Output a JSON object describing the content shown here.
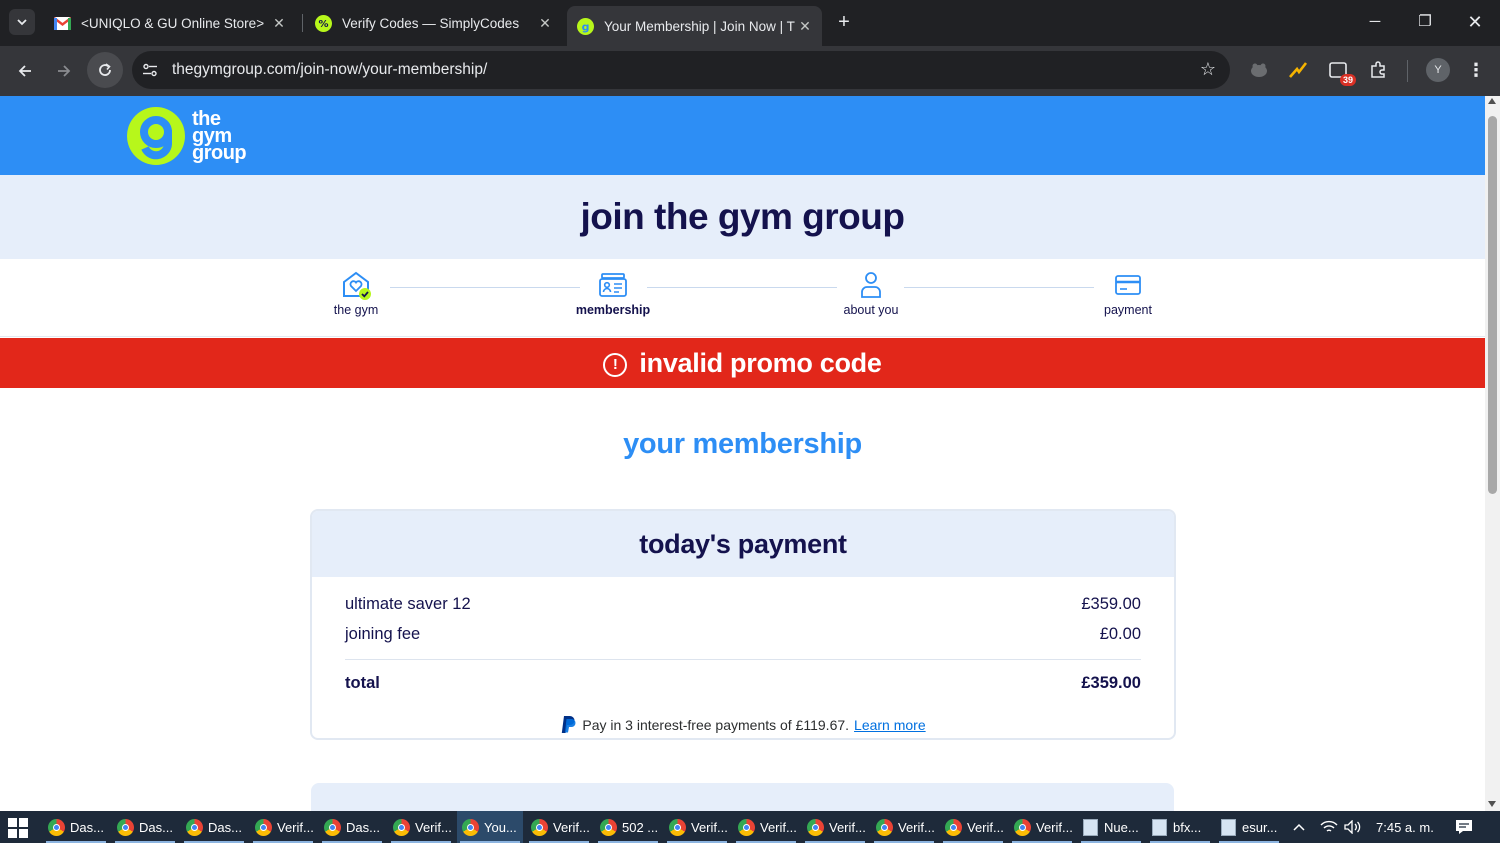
{
  "browser": {
    "tabs": [
      {
        "title": "<UNIQLO & GU Online Store>",
        "favicon": "gmail-icon",
        "active": false
      },
      {
        "title": "Verify Codes — SimplyCodes",
        "favicon": "simplycodes-icon",
        "active": false
      },
      {
        "title": "Your Membership | Join Now | T",
        "favicon": "gymgroup-icon",
        "active": true
      }
    ],
    "url": "thegymgroup.com/join-now/your-membership/",
    "extension_badge": "39",
    "profile_initial": "Y"
  },
  "page": {
    "logo_text": [
      "the",
      "gym",
      "group"
    ],
    "join_title": "join the gym group",
    "steps": [
      {
        "label": "the gym",
        "icon": "heart-house-icon",
        "completed": true,
        "current": false
      },
      {
        "label": "membership",
        "icon": "id-card-icon",
        "completed": false,
        "current": true
      },
      {
        "label": "about you",
        "icon": "person-icon",
        "completed": false,
        "current": false
      },
      {
        "label": "payment",
        "icon": "credit-card-icon",
        "completed": false,
        "current": false
      }
    ],
    "alert": {
      "icon": "!",
      "text": "invalid promo code"
    },
    "section_title": "your membership",
    "todays_payment": {
      "title": "today's payment",
      "lines": [
        {
          "label": "ultimate saver 12",
          "amount": "£359.00"
        },
        {
          "label": "joining fee",
          "amount": "£0.00"
        }
      ],
      "total_label": "total",
      "total_amount": "£359.00",
      "paypal_text": "Pay in 3 interest-free payments of £119.67.",
      "paypal_link": "Learn more"
    },
    "colors": {
      "brand_blue": "#2d8ef5",
      "navy": "#14124d",
      "lime": "#b7f71b",
      "alert_red": "#e2271a",
      "light_band": "#e6eefa"
    }
  },
  "taskbar": {
    "items": [
      {
        "label": "Das...",
        "icon": "chrome-icon",
        "active": false
      },
      {
        "label": "Das...",
        "icon": "chrome-icon",
        "active": false
      },
      {
        "label": "Das...",
        "icon": "chrome-icon",
        "active": false
      },
      {
        "label": "Verif...",
        "icon": "chrome-icon",
        "active": false
      },
      {
        "label": "Das...",
        "icon": "chrome-icon",
        "active": false
      },
      {
        "label": "Verif...",
        "icon": "chrome-icon",
        "active": false
      },
      {
        "label": "You...",
        "icon": "chrome-icon",
        "active": true
      },
      {
        "label": "Verif...",
        "icon": "chrome-icon",
        "active": false
      },
      {
        "label": "502 ...",
        "icon": "chrome-icon",
        "active": false
      },
      {
        "label": "Verif...",
        "icon": "chrome-icon",
        "active": false
      },
      {
        "label": "Verif...",
        "icon": "chrome-icon",
        "active": false
      },
      {
        "label": "Verif...",
        "icon": "chrome-icon",
        "active": false
      },
      {
        "label": "Verif...",
        "icon": "chrome-icon",
        "active": false
      },
      {
        "label": "Verif...",
        "icon": "chrome-icon",
        "active": false
      },
      {
        "label": "Verif...",
        "icon": "chrome-icon",
        "active": false
      },
      {
        "label": "Nue...",
        "icon": "notepad-icon",
        "active": false
      },
      {
        "label": "bfx...",
        "icon": "notepad-icon",
        "active": false
      },
      {
        "label": "esur...",
        "icon": "notepad-icon",
        "active": false
      }
    ],
    "clock": "7:45 a. m."
  }
}
